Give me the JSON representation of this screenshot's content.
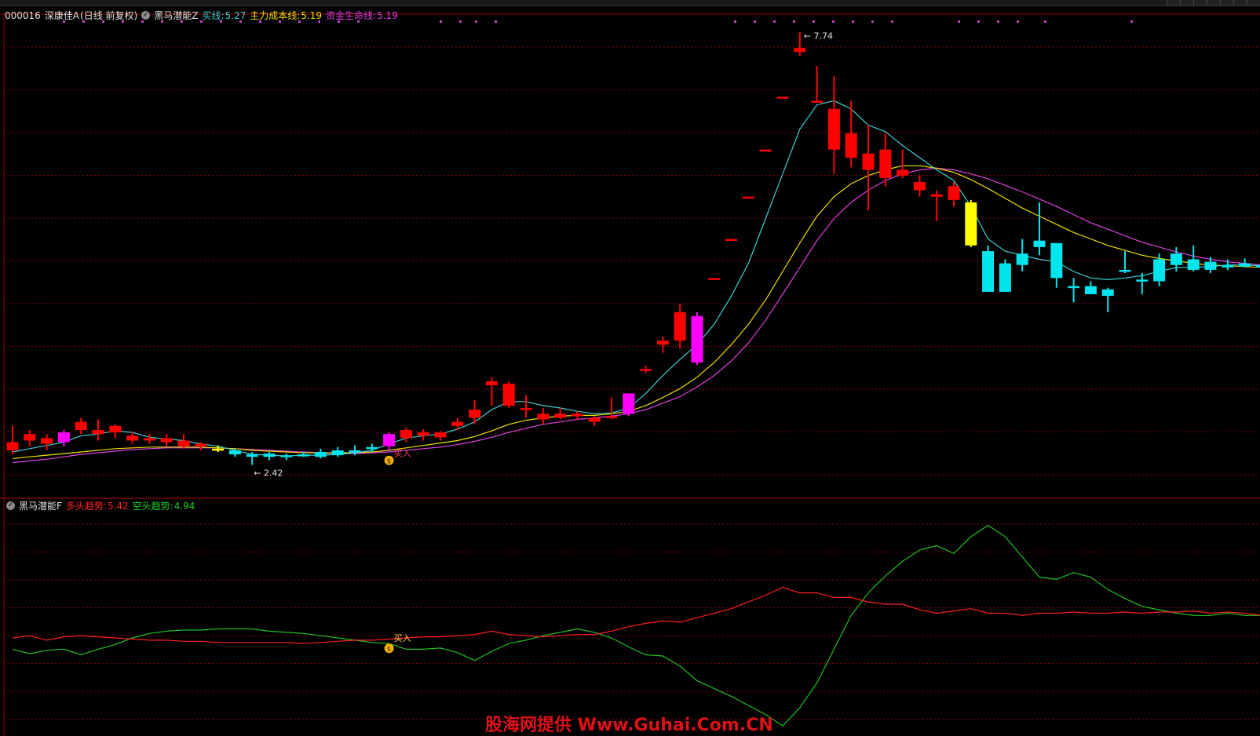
{
  "header": {
    "stock_code": "000016",
    "stock_name": "深康佳A",
    "mode": "(日线 前复权)",
    "indicator_main": "黑马潜能Z",
    "lines": [
      {
        "label": "买线:",
        "value": "5.27",
        "color": "#3ecfd6"
      },
      {
        "label": "主力成本线:",
        "value": "5.19",
        "color": "#f0e000"
      },
      {
        "label": "资金生命线:",
        "value": "5.19",
        "color": "#e040e0"
      }
    ]
  },
  "sub_header": {
    "indicator_sub": "黑马潜能F",
    "lines": [
      {
        "label": "多头趋势:",
        "value": "5.42",
        "color": "#ff2020"
      },
      {
        "label": "空头趋势:",
        "value": "4.94",
        "color": "#20d020"
      }
    ]
  },
  "annotations": {
    "high_price": "7.74",
    "low_price": "2.42",
    "buy_label": "买入",
    "buy_label_sub": "买入"
  },
  "watermark": "股海网提供 Www.Guhai.Com.CN",
  "colors": {
    "up": "#ff0000",
    "down": "#00e5ee",
    "grid": "#8b0000",
    "buy_line": "#3ecfd6",
    "cost_line": "#f0e000",
    "life_line": "#e040e0",
    "long_trend": "#ff2020",
    "short_trend": "#20c020"
  },
  "chart_data": {
    "type": "candlestick",
    "candles": [
      {
        "o": 2.7,
        "h": 2.9,
        "l": 2.55,
        "c": 2.6,
        "col": "up"
      },
      {
        "o": 2.72,
        "h": 2.85,
        "l": 2.65,
        "c": 2.8,
        "col": "up"
      },
      {
        "o": 2.68,
        "h": 2.8,
        "l": 2.6,
        "c": 2.75,
        "col": "up"
      },
      {
        "o": 2.7,
        "h": 2.85,
        "l": 2.65,
        "c": 2.82,
        "col": "magenta"
      },
      {
        "o": 2.85,
        "h": 3.0,
        "l": 2.8,
        "c": 2.95,
        "col": "up"
      },
      {
        "o": 2.8,
        "h": 2.98,
        "l": 2.72,
        "c": 2.85,
        "col": "up"
      },
      {
        "o": 2.82,
        "h": 2.92,
        "l": 2.75,
        "c": 2.9,
        "col": "up"
      },
      {
        "o": 2.78,
        "h": 2.82,
        "l": 2.68,
        "c": 2.72,
        "col": "up"
      },
      {
        "o": 2.75,
        "h": 2.8,
        "l": 2.68,
        "c": 2.72,
        "col": "up"
      },
      {
        "o": 2.7,
        "h": 2.8,
        "l": 2.65,
        "c": 2.75,
        "col": "up"
      },
      {
        "o": 2.72,
        "h": 2.8,
        "l": 2.62,
        "c": 2.65,
        "col": "up"
      },
      {
        "o": 2.68,
        "h": 2.7,
        "l": 2.6,
        "c": 2.65,
        "col": "up"
      },
      {
        "o": 2.62,
        "h": 2.66,
        "l": 2.58,
        "c": 2.6,
        "col": "yellow"
      },
      {
        "o": 2.6,
        "h": 2.62,
        "l": 2.52,
        "c": 2.55,
        "col": "down"
      },
      {
        "o": 2.55,
        "h": 2.58,
        "l": 2.42,
        "c": 2.52,
        "col": "down"
      },
      {
        "o": 2.52,
        "h": 2.58,
        "l": 2.48,
        "c": 2.56,
        "col": "down"
      },
      {
        "o": 2.52,
        "h": 2.56,
        "l": 2.48,
        "c": 2.54,
        "col": "down"
      },
      {
        "o": 2.55,
        "h": 2.58,
        "l": 2.52,
        "c": 2.54,
        "col": "down"
      },
      {
        "o": 2.58,
        "h": 2.62,
        "l": 2.5,
        "c": 2.52,
        "col": "down"
      },
      {
        "o": 2.6,
        "h": 2.64,
        "l": 2.52,
        "c": 2.54,
        "col": "down"
      },
      {
        "o": 2.6,
        "h": 2.66,
        "l": 2.54,
        "c": 2.58,
        "col": "down"
      },
      {
        "o": 2.62,
        "h": 2.68,
        "l": 2.58,
        "c": 2.64,
        "col": "down"
      },
      {
        "o": 2.65,
        "h": 2.82,
        "l": 2.6,
        "c": 2.8,
        "col": "magenta"
      },
      {
        "o": 2.75,
        "h": 2.88,
        "l": 2.7,
        "c": 2.85,
        "col": "up"
      },
      {
        "o": 2.78,
        "h": 2.86,
        "l": 2.72,
        "c": 2.82,
        "col": "up"
      },
      {
        "o": 2.76,
        "h": 2.84,
        "l": 2.72,
        "c": 2.82,
        "col": "up"
      },
      {
        "o": 2.9,
        "h": 3.0,
        "l": 2.85,
        "c": 2.95,
        "col": "up"
      },
      {
        "o": 3.1,
        "h": 3.22,
        "l": 2.92,
        "c": 3.0,
        "col": "up"
      },
      {
        "o": 3.4,
        "h": 3.5,
        "l": 3.15,
        "c": 3.45,
        "col": "up"
      },
      {
        "o": 3.15,
        "h": 3.45,
        "l": 3.12,
        "c": 3.42,
        "col": "up"
      },
      {
        "o": 3.12,
        "h": 3.28,
        "l": 3.0,
        "c": 3.1,
        "col": "up"
      },
      {
        "o": 3.05,
        "h": 3.12,
        "l": 2.92,
        "c": 2.98,
        "col": "up"
      },
      {
        "o": 3.05,
        "h": 3.12,
        "l": 2.98,
        "c": 3.0,
        "col": "up"
      },
      {
        "o": 3.05,
        "h": 3.08,
        "l": 2.98,
        "c": 3.02,
        "col": "up"
      },
      {
        "o": 3.0,
        "h": 3.02,
        "l": 2.9,
        "c": 2.95,
        "col": "up"
      },
      {
        "o": 3.0,
        "h": 3.25,
        "l": 2.98,
        "c": 3.02,
        "col": "up"
      },
      {
        "o": 3.05,
        "h": 3.3,
        "l": 3.02,
        "c": 3.3,
        "col": "magenta"
      },
      {
        "o": 3.6,
        "h": 3.64,
        "l": 3.55,
        "c": 3.6,
        "col": "up"
      },
      {
        "o": 3.9,
        "h": 4.0,
        "l": 3.8,
        "c": 3.95,
        "col": "up"
      },
      {
        "o": 4.3,
        "h": 4.4,
        "l": 3.85,
        "c": 3.95,
        "col": "up"
      },
      {
        "o": 3.68,
        "h": 4.3,
        "l": 3.65,
        "c": 4.25,
        "col": "magenta"
      },
      {
        "o": 4.72,
        "h": 4.72,
        "l": 4.72,
        "c": 4.72,
        "col": "up"
      },
      {
        "o": 5.2,
        "h": 5.2,
        "l": 5.2,
        "c": 5.2,
        "col": "up"
      },
      {
        "o": 5.72,
        "h": 5.72,
        "l": 5.72,
        "c": 5.72,
        "col": "up"
      },
      {
        "o": 6.3,
        "h": 6.3,
        "l": 6.3,
        "c": 6.3,
        "col": "up"
      },
      {
        "o": 6.95,
        "h": 6.95,
        "l": 6.95,
        "c": 6.95,
        "col": "up"
      },
      {
        "o": 7.55,
        "h": 7.74,
        "l": 7.45,
        "c": 7.5,
        "col": "up"
      },
      {
        "o": 6.9,
        "h": 7.33,
        "l": 6.9,
        "c": 6.9,
        "col": "up"
      },
      {
        "o": 6.8,
        "h": 7.2,
        "l": 6.0,
        "c": 6.3,
        "col": "up"
      },
      {
        "o": 6.5,
        "h": 6.9,
        "l": 6.08,
        "c": 6.2,
        "col": "up"
      },
      {
        "o": 6.25,
        "h": 6.6,
        "l": 5.55,
        "c": 6.05,
        "col": "up"
      },
      {
        "o": 6.3,
        "h": 6.5,
        "l": 5.85,
        "c": 5.95,
        "col": "up"
      },
      {
        "o": 6.05,
        "h": 6.3,
        "l": 5.95,
        "c": 5.98,
        "col": "up"
      },
      {
        "o": 5.9,
        "h": 5.98,
        "l": 5.72,
        "c": 5.8,
        "col": "up"
      },
      {
        "o": 5.75,
        "h": 5.8,
        "l": 5.42,
        "c": 5.72,
        "col": "up"
      },
      {
        "o": 5.85,
        "h": 5.9,
        "l": 5.6,
        "c": 5.68,
        "col": "up"
      },
      {
        "o": 5.65,
        "h": 5.68,
        "l": 5.1,
        "c": 5.12,
        "col": "yellow"
      },
      {
        "o": 5.05,
        "h": 5.12,
        "l": 4.55,
        "c": 4.55,
        "col": "down"
      },
      {
        "o": 4.9,
        "h": 4.95,
        "l": 4.55,
        "c": 4.55,
        "col": "down"
      },
      {
        "o": 4.88,
        "h": 5.2,
        "l": 4.8,
        "c": 5.02,
        "col": "down"
      },
      {
        "o": 5.18,
        "h": 5.65,
        "l": 5.0,
        "c": 5.1,
        "col": "down"
      },
      {
        "o": 5.15,
        "h": 5.15,
        "l": 4.6,
        "c": 4.72,
        "col": "down"
      },
      {
        "o": 4.62,
        "h": 4.72,
        "l": 4.42,
        "c": 4.6,
        "col": "down"
      },
      {
        "o": 4.62,
        "h": 4.68,
        "l": 4.52,
        "c": 4.52,
        "col": "down"
      },
      {
        "o": 4.58,
        "h": 4.6,
        "l": 4.3,
        "c": 4.5,
        "col": "down"
      },
      {
        "o": 4.82,
        "h": 5.05,
        "l": 4.78,
        "c": 4.82,
        "col": "down"
      },
      {
        "o": 4.7,
        "h": 4.78,
        "l": 4.52,
        "c": 4.7,
        "col": "down"
      },
      {
        "o": 4.95,
        "h": 5.02,
        "l": 4.62,
        "c": 4.68,
        "col": "down"
      },
      {
        "o": 5.02,
        "h": 5.1,
        "l": 4.8,
        "c": 4.88,
        "col": "down"
      },
      {
        "o": 4.95,
        "h": 5.12,
        "l": 4.8,
        "c": 4.82,
        "col": "down"
      },
      {
        "o": 4.92,
        "h": 4.98,
        "l": 4.78,
        "c": 4.82,
        "col": "down"
      },
      {
        "o": 4.85,
        "h": 4.95,
        "l": 4.82,
        "c": 4.88,
        "col": "down"
      },
      {
        "o": 4.9,
        "h": 4.96,
        "l": 4.85,
        "c": 4.86,
        "col": "down"
      },
      {
        "o": 4.88,
        "h": 4.98,
        "l": 4.8,
        "c": 4.85,
        "col": "down"
      }
    ],
    "buy_line": [
      2.58,
      2.62,
      2.66,
      2.7,
      2.78,
      2.8,
      2.84,
      2.82,
      2.76,
      2.74,
      2.72,
      2.68,
      2.65,
      2.6,
      2.55,
      2.54,
      2.53,
      2.54,
      2.54,
      2.55,
      2.57,
      2.6,
      2.68,
      2.75,
      2.78,
      2.8,
      2.86,
      2.95,
      3.1,
      3.2,
      3.2,
      3.15,
      3.12,
      3.08,
      3.05,
      3.06,
      3.12,
      3.3,
      3.52,
      3.72,
      3.9,
      4.15,
      4.5,
      4.9,
      5.45,
      6.0,
      6.55,
      6.85,
      6.9,
      6.8,
      6.6,
      6.52,
      6.35,
      6.2,
      6.05,
      5.92,
      5.6,
      5.2,
      5.05,
      5.0,
      4.95,
      4.92,
      4.8,
      4.72,
      4.7,
      4.72,
      4.75,
      4.8,
      4.85,
      4.85,
      4.86,
      4.88,
      4.88,
      4.87
    ],
    "cost_line": [
      2.5,
      2.52,
      2.54,
      2.56,
      2.58,
      2.6,
      2.62,
      2.63,
      2.64,
      2.64,
      2.64,
      2.64,
      2.63,
      2.62,
      2.6,
      2.59,
      2.58,
      2.57,
      2.57,
      2.57,
      2.57,
      2.58,
      2.6,
      2.63,
      2.66,
      2.69,
      2.72,
      2.77,
      2.84,
      2.92,
      2.97,
      3.0,
      3.02,
      3.03,
      3.03,
      3.05,
      3.08,
      3.15,
      3.25,
      3.36,
      3.5,
      3.68,
      3.9,
      4.15,
      4.45,
      4.8,
      5.15,
      5.48,
      5.72,
      5.88,
      5.98,
      6.05,
      6.1,
      6.1,
      6.07,
      6.02,
      5.93,
      5.82,
      5.7,
      5.58,
      5.48,
      5.38,
      5.28,
      5.2,
      5.12,
      5.06,
      5.0,
      4.96,
      4.93,
      4.9,
      4.88,
      4.87,
      4.86,
      4.85
    ],
    "life_line": [
      2.45,
      2.47,
      2.49,
      2.52,
      2.55,
      2.57,
      2.59,
      2.61,
      2.62,
      2.63,
      2.63,
      2.63,
      2.63,
      2.62,
      2.61,
      2.6,
      2.59,
      2.58,
      2.57,
      2.56,
      2.56,
      2.57,
      2.58,
      2.6,
      2.62,
      2.64,
      2.67,
      2.71,
      2.76,
      2.82,
      2.87,
      2.92,
      2.95,
      2.98,
      3.0,
      3.02,
      3.05,
      3.1,
      3.18,
      3.26,
      3.38,
      3.52,
      3.7,
      3.92,
      4.2,
      4.52,
      4.85,
      5.18,
      5.45,
      5.65,
      5.8,
      5.92,
      6.0,
      6.05,
      6.07,
      6.05,
      6.0,
      5.94,
      5.86,
      5.78,
      5.69,
      5.6,
      5.5,
      5.4,
      5.32,
      5.24,
      5.16,
      5.1,
      5.04,
      4.99,
      4.95,
      4.92,
      4.9,
      4.88
    ],
    "long_trend": [
      0.3,
      0.32,
      0.28,
      0.31,
      0.32,
      0.31,
      0.3,
      0.29,
      0.28,
      0.28,
      0.27,
      0.27,
      0.26,
      0.26,
      0.26,
      0.26,
      0.26,
      0.25,
      0.26,
      0.27,
      0.28,
      0.28,
      0.29,
      0.3,
      0.31,
      0.31,
      0.32,
      0.33,
      0.36,
      0.33,
      0.32,
      0.31,
      0.32,
      0.33,
      0.33,
      0.36,
      0.4,
      0.43,
      0.45,
      0.44,
      0.48,
      0.52,
      0.56,
      0.62,
      0.68,
      0.75,
      0.7,
      0.7,
      0.66,
      0.66,
      0.62,
      0.6,
      0.6,
      0.55,
      0.52,
      0.54,
      0.56,
      0.52,
      0.52,
      0.5,
      0.52,
      0.52,
      0.53,
      0.52,
      0.52,
      0.53,
      0.52,
      0.53,
      0.53,
      0.54,
      0.52,
      0.53,
      0.52,
      0.5
    ],
    "short_trend": [
      0.2,
      0.16,
      0.19,
      0.2,
      0.15,
      0.2,
      0.24,
      0.3,
      0.34,
      0.36,
      0.37,
      0.37,
      0.38,
      0.38,
      0.38,
      0.36,
      0.35,
      0.34,
      0.32,
      0.3,
      0.28,
      0.26,
      0.25,
      0.2,
      0.2,
      0.21,
      0.17,
      0.1,
      0.18,
      0.25,
      0.28,
      0.32,
      0.35,
      0.38,
      0.35,
      0.3,
      0.22,
      0.15,
      0.14,
      0.05,
      -0.08,
      -0.15,
      -0.22,
      -0.3,
      -0.38,
      -0.48,
      -0.32,
      -0.1,
      0.2,
      0.5,
      0.7,
      0.85,
      0.98,
      1.08,
      1.12,
      1.05,
      1.2,
      1.3,
      1.2,
      1.02,
      0.84,
      0.82,
      0.88,
      0.84,
      0.73,
      0.65,
      0.58,
      0.55,
      0.52,
      0.5,
      0.5,
      0.52,
      0.5,
      0.5
    ],
    "y_range_main": [
      2.3,
      7.85
    ],
    "y_range_sub": [
      -0.55,
      1.45
    ]
  }
}
